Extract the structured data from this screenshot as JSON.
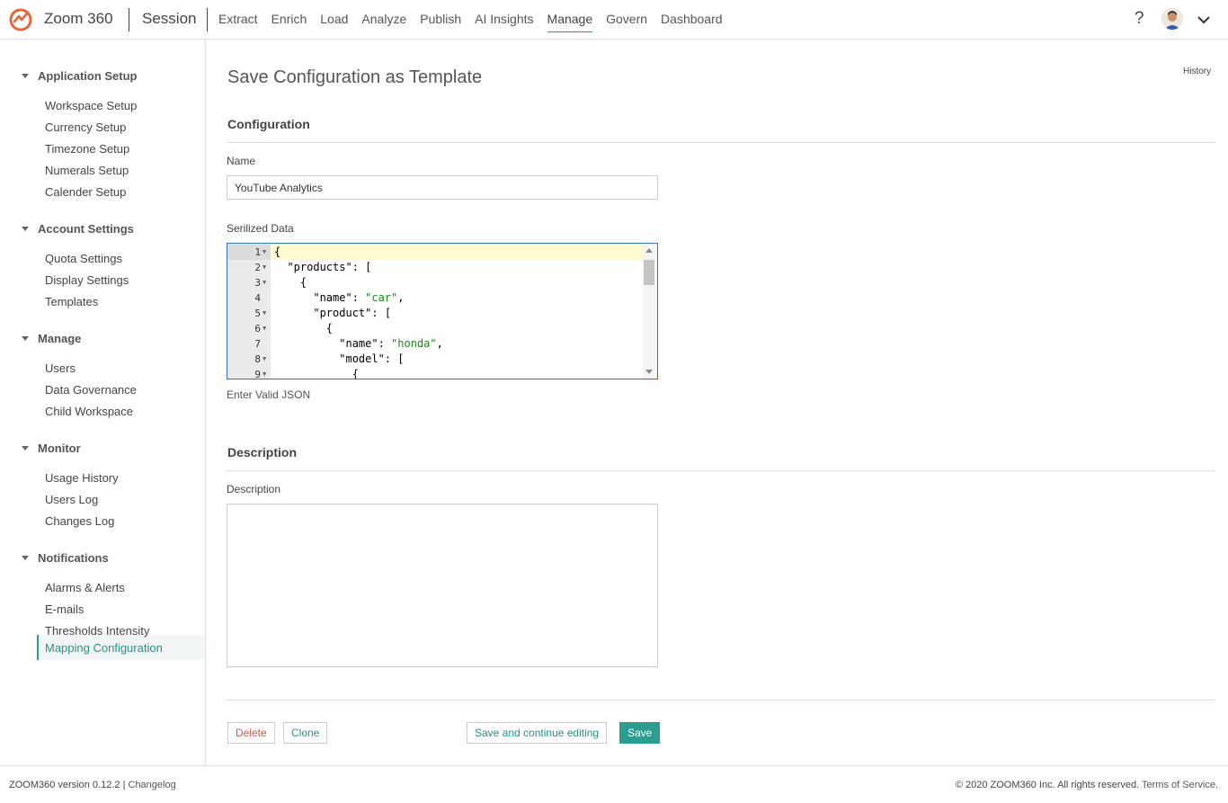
{
  "app": {
    "title": "Zoom 360",
    "session": "Session",
    "brand_color": "#e8663d",
    "accent_color": "#2a9d8f"
  },
  "nav": {
    "items": [
      "Extract",
      "Enrich",
      "Load",
      "Analyze",
      "Publish",
      "AI Insights",
      "Manage",
      "Govern",
      "Dashboard"
    ],
    "active": "Manage",
    "help": "?"
  },
  "sidebar": {
    "groups": [
      {
        "title": "Application Setup",
        "items": [
          "Workspace Setup",
          "Currency Setup",
          "Timezone Setup",
          "Numerals Setup",
          "Calender Setup"
        ]
      },
      {
        "title": "Account Settings",
        "items": [
          "Quota Settings",
          "Display Settings",
          "Templates"
        ]
      },
      {
        "title": "Manage",
        "items": [
          "Users",
          "Data Governance",
          "Child Workspace"
        ]
      },
      {
        "title": "Monitor",
        "items": [
          "Usage History",
          "Users Log",
          "Changes Log"
        ]
      },
      {
        "title": "Notifications",
        "items": [
          "Alarms & Alerts",
          "E-mails",
          "Thresholds Intensity",
          "Mapping Configuration"
        ]
      }
    ],
    "active_item": "Mapping Configuration"
  },
  "main": {
    "page_title": "Save Configuration as Template",
    "history_link": "History",
    "config_section": "Configuration",
    "name_label": "Name",
    "name_value": "YouTube Analytics",
    "data_label": "Serilized Data",
    "editor_lines": [
      {
        "n": "1",
        "fold": true,
        "code": "{"
      },
      {
        "n": "2",
        "fold": true,
        "code": "  \"products\": ["
      },
      {
        "n": "3",
        "fold": true,
        "code": "    {"
      },
      {
        "n": "4",
        "fold": false,
        "code": "      \"name\": \"car\","
      },
      {
        "n": "5",
        "fold": true,
        "code": "      \"product\": ["
      },
      {
        "n": "6",
        "fold": true,
        "code": "        {"
      },
      {
        "n": "7",
        "fold": false,
        "code": "          \"name\": \"honda\","
      },
      {
        "n": "8",
        "fold": true,
        "code": "          \"model\": ["
      },
      {
        "n": "9",
        "fold": true,
        "code": "            {"
      }
    ],
    "json_hint": "Enter Valid JSON",
    "description_section": "Description",
    "description_label": "Description",
    "description_value": "",
    "buttons": {
      "delete": "Delete",
      "clone": "Clone",
      "save_continue": "Save and continue editing",
      "save": "Save"
    }
  },
  "footer": {
    "version": "ZOOM360 version 0.12.2",
    "separator": "|",
    "changelog": "Changelog",
    "copyright": "© 2020 ZOOM360 Inc. All rights reserved.",
    "terms": "Terms of Service."
  }
}
